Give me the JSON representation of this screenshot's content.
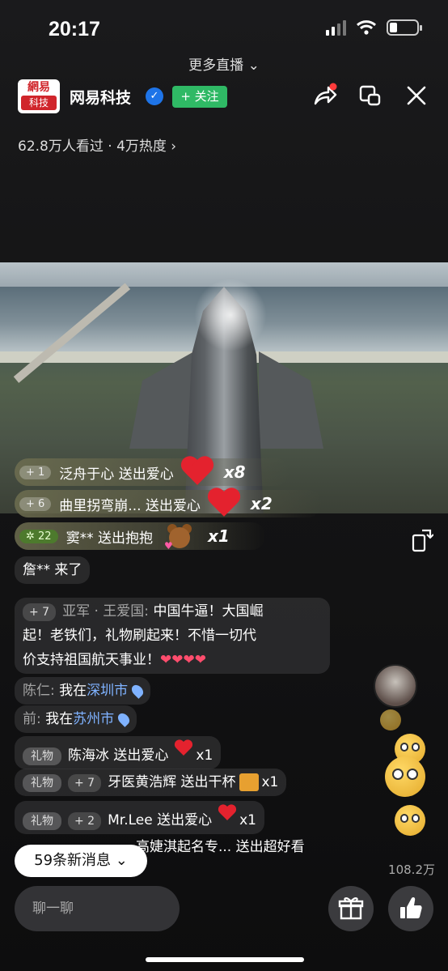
{
  "status": {
    "time": "20:17"
  },
  "header": {
    "more_live": "更多直播 ⌄",
    "logo_top": "網易",
    "logo_bottom": "科技",
    "channel_name": "网易科技",
    "verified": "✓",
    "follow_label": "+ 关注",
    "viewers": "62.8万人看过 · 4万热度 ›"
  },
  "gift_banners": [
    {
      "level": "+ 1",
      "text": "泛舟于心 送出爱心",
      "multiplier": "x8"
    },
    {
      "level": "+ 6",
      "text": "曲里拐弯崩... 送出爱心",
      "multiplier": "x2"
    },
    {
      "level": "✲ 22",
      "text": "窦** 送出抱抱",
      "multiplier": "x1"
    }
  ],
  "chat": {
    "join": "詹** 来了",
    "msg1_level": "+ 7",
    "msg1_nick": "亚军 · 王爱国:",
    "msg1_line1": "中国牛逼！大国崛",
    "msg1_line2": "起！老铁们，礼物刷起来！不惜一切代",
    "msg1_line3": "价支持祖国航天事业！",
    "msg1_emoji": "❤❤❤❤",
    "loc1_nick": "陈仁:",
    "loc1_text": "我在",
    "loc1_city": "深圳市",
    "loc2_nick": "前:",
    "loc2_text": "我在",
    "loc2_city": "苏州市",
    "gift_tag": "礼物",
    "g1_text": "陈海冰 送出爱心",
    "g1_mult": "x1",
    "g2_level": "+ 7",
    "g2_text": "牙医黄浩辉 送出干杯",
    "g2_mult": "x1",
    "g3_level": "+ 2",
    "g3_text": "Mr.Lee 送出爱心",
    "g3_mult": "x1",
    "g4_text": "高婕淇起名专... 送出超好看"
  },
  "bottom": {
    "new_messages": "59条新消息 ⌄",
    "likes": "108.2万",
    "chat_placeholder": "聊一聊"
  }
}
